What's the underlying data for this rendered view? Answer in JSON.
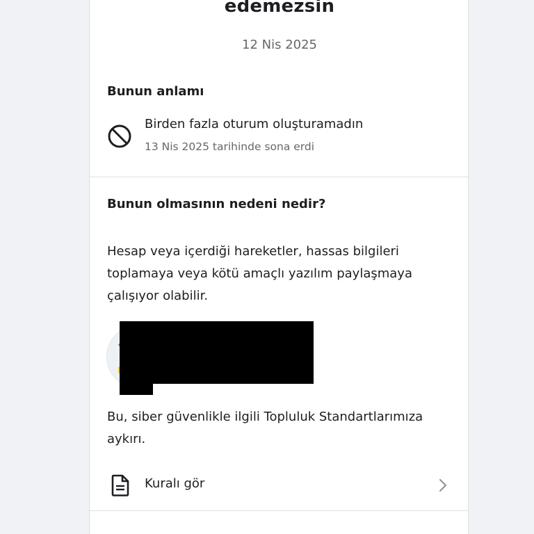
{
  "header": {
    "title": "edemezsin",
    "date": "12 Nis 2025"
  },
  "meaning": {
    "heading": "Bunun anlamı",
    "restriction_title": "Birden fazla oturum oluşturamadın",
    "restriction_expiry": "13 Nis 2025 tarihinde sona erdi",
    "icon": "block-icon"
  },
  "reason": {
    "heading": "Bunun olmasının nedeni nedir?",
    "explanation": "Hesap veya içerdiği hareketler, hassas bilgileri toplamaya veya kötü amaçlı yazılım paylaşmaya çalışıyor olabilir.",
    "policy_note": "Bu, siber güvenlikle ilgili Topluluk Standartlarımıza aykırı."
  },
  "rule_link": {
    "label": "Kuralı gör",
    "icon": "document-icon",
    "chevron": "chevron-right-icon"
  },
  "colors": {
    "background": "#f0f2f5",
    "card": "#ffffff",
    "text": "#1c1e21",
    "secondary_text": "#65676b",
    "divider": "#dddfe2"
  }
}
